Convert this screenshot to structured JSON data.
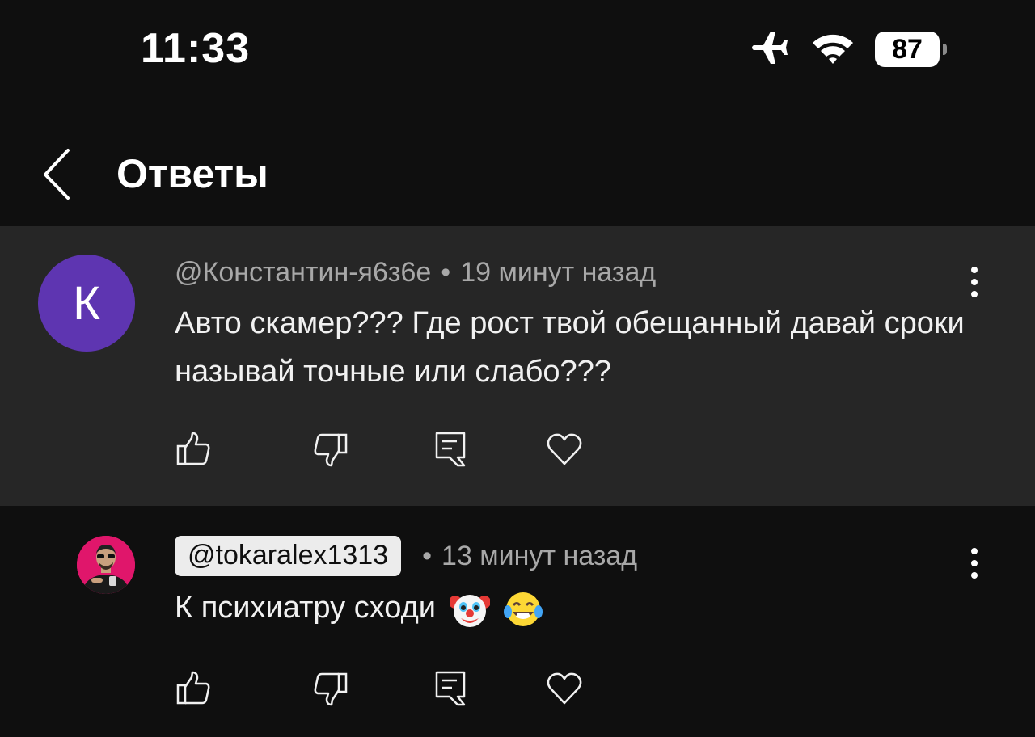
{
  "status_bar": {
    "time": "11:33",
    "battery": "87",
    "icons": [
      "airplane-icon",
      "wifi-icon",
      "battery-icon"
    ]
  },
  "header": {
    "title": "Ответы",
    "back_icon": "chevron-left-icon"
  },
  "comments": [
    {
      "author": "@Константин-я6з6е",
      "time": "19 минут назад",
      "avatar_letter": "К",
      "text": "Авто скамер??? Где рост твой обещанный давай сроки называй точные или слабо???",
      "avatar_color": "#5e35b1"
    },
    {
      "author": "@tokaralex1313",
      "time": "13 минут назад",
      "text": "К психиатру сходи",
      "emojis": [
        "clown-face-emoji",
        "tears-of-joy-emoji"
      ],
      "avatar_color": "#e0166b"
    }
  ],
  "actions": [
    "like-icon",
    "dislike-icon",
    "reply-icon",
    "heart-icon"
  ],
  "colors": {
    "background": "#0f0f0f",
    "highlight": "#262626",
    "secondary_text": "#a8a8a8",
    "primary_text": "#f1f1f1"
  }
}
